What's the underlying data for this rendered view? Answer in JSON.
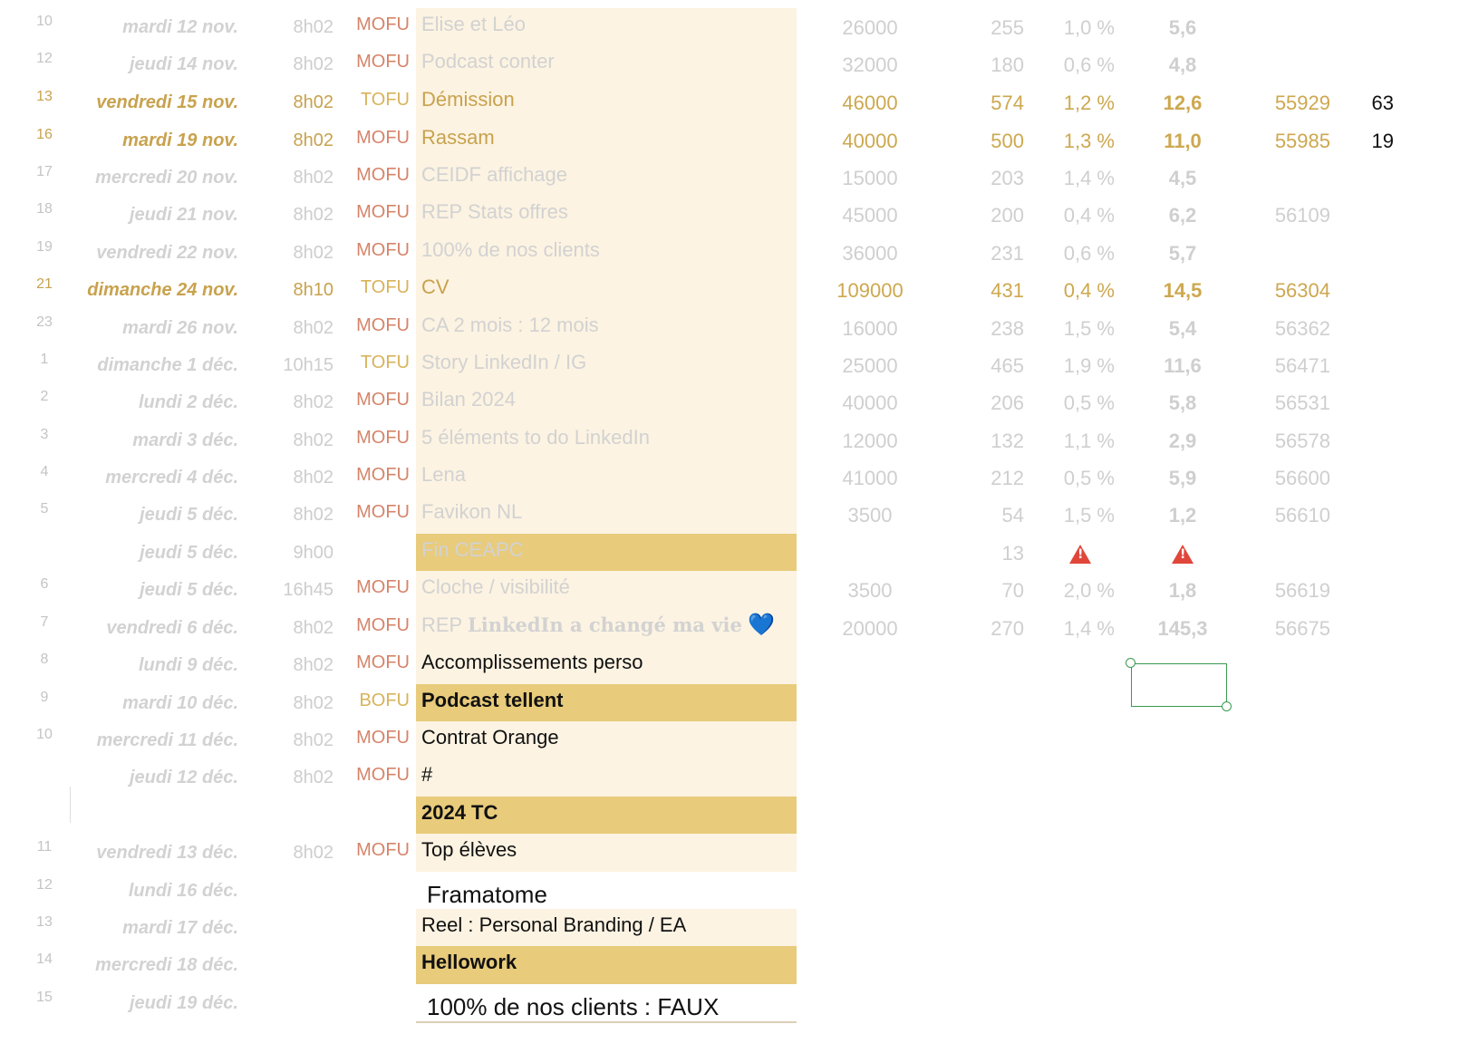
{
  "rows": [
    {
      "num": "10",
      "date": "mardi 12 nov.",
      "time": "8h02",
      "funnel": "MOFU",
      "title": "Elise et Léo",
      "views": "26000",
      "reactions": "255",
      "rate": "1,0 %",
      "score": "5,6",
      "followers": "",
      "delta": "",
      "style": "grey",
      "highlight": false
    },
    {
      "num": "12",
      "date": "jeudi 14 nov.",
      "time": "8h02",
      "funnel": "MOFU",
      "title": "Podcast conter",
      "views": "32000",
      "reactions": "180",
      "rate": "0,6 %",
      "score": "4,8",
      "followers": "",
      "delta": "",
      "style": "grey",
      "highlight": false
    },
    {
      "num": "13",
      "date": "vendredi 15 nov.",
      "time": "8h02",
      "funnel": "TOFU",
      "title": "Démission",
      "views": "46000",
      "reactions": "574",
      "rate": "1,2 %",
      "score": "12,6",
      "followers": "55929",
      "delta": "63",
      "style": "gold",
      "highlight": false
    },
    {
      "num": "16",
      "date": "mardi 19 nov.",
      "time": "8h02",
      "funnel": "MOFU",
      "title": "Rassam",
      "views": "40000",
      "reactions": "500",
      "rate": "1,3 %",
      "score": "11,0",
      "followers": "55985",
      "delta": "19",
      "style": "gold",
      "highlight": false
    },
    {
      "num": "17",
      "date": "mercredi 20 nov.",
      "time": "8h02",
      "funnel": "MOFU",
      "title": "CEIDF affichage",
      "views": "15000",
      "reactions": "203",
      "rate": "1,4 %",
      "score": "4,5",
      "followers": "",
      "delta": "",
      "style": "grey",
      "highlight": false
    },
    {
      "num": "18",
      "date": "jeudi 21 nov.",
      "time": "8h02",
      "funnel": "MOFU",
      "title": "REP Stats offres",
      "views": "45000",
      "reactions": "200",
      "rate": "0,4 %",
      "score": "6,2",
      "followers": "56109",
      "delta": "",
      "style": "grey",
      "highlight": false
    },
    {
      "num": "19",
      "date": "vendredi 22 nov.",
      "time": "8h02",
      "funnel": "MOFU",
      "title": "100% de nos clients",
      "views": "36000",
      "reactions": "231",
      "rate": "0,6 %",
      "score": "5,7",
      "followers": "",
      "delta": "",
      "style": "grey",
      "highlight": false
    },
    {
      "num": "21",
      "date": "dimanche 24 nov.",
      "time": "8h10",
      "funnel": "TOFU",
      "title": "CV",
      "views": "109000",
      "reactions": "431",
      "rate": "0,4 %",
      "score": "14,5",
      "followers": "56304",
      "delta": "",
      "style": "gold",
      "highlight": false
    },
    {
      "num": "23",
      "date": "mardi 26 nov.",
      "time": "8h02",
      "funnel": "MOFU",
      "title": "CA 2 mois : 12 mois",
      "views": "16000",
      "reactions": "238",
      "rate": "1,5 %",
      "score": "5,4",
      "followers": "56362",
      "delta": "",
      "style": "grey",
      "highlight": false
    },
    {
      "num": "1",
      "date": "dimanche 1 déc.",
      "time": "10h15",
      "funnel": "TOFU",
      "title": "Story LinkedIn / IG",
      "views": "25000",
      "reactions": "465",
      "rate": "1,9 %",
      "score": "11,6",
      "followers": "56471",
      "delta": "",
      "style": "grey",
      "highlight": false
    },
    {
      "num": "2",
      "date": "lundi 2 déc.",
      "time": "8h02",
      "funnel": "MOFU",
      "title": "Bilan 2024",
      "views": "40000",
      "reactions": "206",
      "rate": "0,5 %",
      "score": "5,8",
      "followers": "56531",
      "delta": "",
      "style": "grey",
      "highlight": false
    },
    {
      "num": "3",
      "date": "mardi 3 déc.",
      "time": "8h02",
      "funnel": "MOFU",
      "title": "5 éléments to do LinkedIn",
      "views": "12000",
      "reactions": "132",
      "rate": "1,1 %",
      "score": "2,9",
      "followers": "56578",
      "delta": "",
      "style": "grey",
      "highlight": false
    },
    {
      "num": "4",
      "date": "mercredi 4 déc.",
      "time": "8h02",
      "funnel": "MOFU",
      "title": "Lena",
      "views": "41000",
      "reactions": "212",
      "rate": "0,5 %",
      "score": "5,9",
      "followers": "56600",
      "delta": "",
      "style": "grey",
      "highlight": false
    },
    {
      "num": "5",
      "date": "jeudi 5 déc.",
      "time": "8h02",
      "funnel": "MOFU",
      "title": "Favikon NL",
      "views": "3500",
      "reactions": "54",
      "rate": "1,5 %",
      "score": "1,2",
      "followers": "56610",
      "delta": "",
      "style": "grey",
      "highlight": false
    },
    {
      "num": "",
      "date": "jeudi 5 déc.",
      "time": "9h00",
      "funnel": "",
      "title": "Fin CEAPC",
      "views": "",
      "reactions": "13",
      "rate": "",
      "score": "",
      "followers": "",
      "delta": "",
      "style": "grey",
      "highlight": true,
      "warn": true
    },
    {
      "num": "6",
      "date": "jeudi 5 déc.",
      "time": "16h45",
      "funnel": "MOFU",
      "title": "Cloche / visibilité",
      "views": "3500",
      "reactions": "70",
      "rate": "2,0 %",
      "score": "1,8",
      "followers": "56619",
      "delta": "",
      "style": "grey",
      "highlight": false
    },
    {
      "num": "7",
      "date": "vendredi 6 déc.",
      "time": "8h02",
      "funnel": "MOFU",
      "title": "REP ",
      "title_serif": "LinkedIn a changé ma vie",
      "title_emoji": "💙",
      "views": "20000",
      "reactions": "270",
      "rate": "1,4 %",
      "score": "145,3",
      "followers": "56675",
      "delta": "",
      "style": "grey",
      "highlight": false
    },
    {
      "num": "8",
      "date": "lundi 9 déc.",
      "time": "8h02",
      "funnel": "MOFU",
      "title": "Accomplissements perso",
      "views": "",
      "reactions": "",
      "rate": "",
      "score": "",
      "followers": "",
      "delta": "",
      "style": "grey",
      "highlight": false,
      "dark": true
    },
    {
      "num": "9",
      "date": "mardi 10 déc.",
      "time": "8h02",
      "funnel": "BOFU",
      "title": "Podcast tellent",
      "views": "",
      "reactions": "",
      "rate": "",
      "score": "",
      "followers": "",
      "delta": "",
      "style": "grey",
      "highlight": true,
      "dark": true,
      "bold": true
    },
    {
      "num": "10",
      "date": "mercredi 11 déc.",
      "time": "8h02",
      "funnel": "MOFU",
      "title": "Contrat Orange",
      "views": "",
      "reactions": "",
      "rate": "",
      "score": "",
      "followers": "",
      "delta": "",
      "style": "grey",
      "highlight": false,
      "dark": true
    },
    {
      "num": "",
      "date": "jeudi 12 déc.",
      "time": "8h02",
      "funnel": "MOFU",
      "title": "#",
      "views": "",
      "reactions": "",
      "rate": "",
      "score": "",
      "followers": "",
      "delta": "",
      "style": "grey",
      "highlight": false,
      "dark": true
    },
    {
      "num": "",
      "date": "",
      "time": "",
      "funnel": "",
      "title": "2024 TC",
      "views": "",
      "reactions": "",
      "rate": "",
      "score": "",
      "followers": "",
      "delta": "",
      "style": "grey",
      "highlight": true,
      "dark": true,
      "bold": true
    },
    {
      "num": "11",
      "date": "vendredi 13 déc.",
      "time": "8h02",
      "funnel": "MOFU",
      "title": "Top élèves",
      "views": "",
      "reactions": "",
      "rate": "",
      "score": "",
      "followers": "",
      "delta": "",
      "style": "grey",
      "highlight": false,
      "dark": true
    },
    {
      "num": "12",
      "date": "lundi 16 déc.",
      "time": "",
      "funnel": "",
      "title": "Framatome",
      "views": "",
      "reactions": "",
      "rate": "",
      "score": "",
      "followers": "",
      "delta": "",
      "style": "grey",
      "highlight": false,
      "dark": true,
      "white": true,
      "large": true
    },
    {
      "num": "13",
      "date": "mardi 17 déc.",
      "time": "",
      "funnel": "",
      "title": "Reel : Personal Branding / EA",
      "views": "",
      "reactions": "",
      "rate": "",
      "score": "",
      "followers": "",
      "delta": "",
      "style": "grey",
      "highlight": false,
      "dark": true
    },
    {
      "num": "14",
      "date": "mercredi 18 déc.",
      "time": "",
      "funnel": "",
      "title": "Hellowork",
      "views": "",
      "reactions": "",
      "rate": "",
      "score": "",
      "followers": "",
      "delta": "",
      "style": "grey",
      "highlight": true,
      "dark": true,
      "bold": true
    },
    {
      "num": "15",
      "date": "jeudi 19 déc.",
      "time": "",
      "funnel": "",
      "title": "100% de nos clients : FAUX",
      "views": "",
      "reactions": "",
      "rate": "",
      "score": "",
      "followers": "",
      "delta": "",
      "style": "grey",
      "highlight": false,
      "dark": true,
      "white": true,
      "large": true,
      "underline": true
    }
  ],
  "selection": {
    "active_cell": "empty cell below 145,3"
  },
  "colors": {
    "accent_gold": "#c8a24e",
    "mofu": "#d5846a",
    "highlight_fill": "#e8cb7b",
    "title_fill": "#fcf3e2",
    "selection": "#3a9a4e",
    "warning": "#e0463a"
  }
}
